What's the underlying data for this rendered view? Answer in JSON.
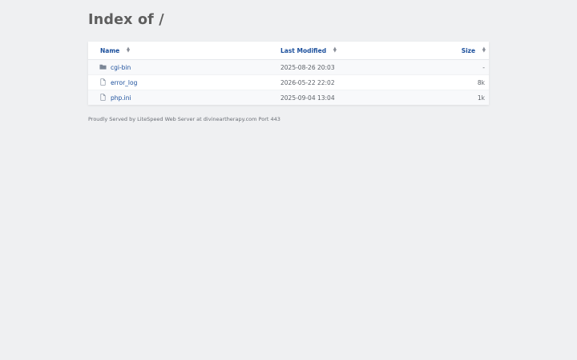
{
  "page": {
    "title": "Index of /"
  },
  "table": {
    "columns": {
      "name": "Name",
      "modified": "Last Modified",
      "size": "Size"
    },
    "rows": [
      {
        "name": "cgi-bin",
        "modified": "2025-08-26 20:03",
        "size": "-",
        "icon": "folder-icon"
      },
      {
        "name": "error_log",
        "modified": "2026-05-22 22:02",
        "size": "8k",
        "icon": "file-icon"
      },
      {
        "name": "php.ini",
        "modified": "2025-09-04 13:04",
        "size": "1k",
        "icon": "file-icon"
      }
    ]
  },
  "footer": {
    "text": "Proudly Served by LiteSpeed Web Server at divineartherapy.com Port 443"
  },
  "colors": {
    "background": "#eff0f2",
    "link": "#1b4f9c",
    "title": "#5e5e5e"
  }
}
